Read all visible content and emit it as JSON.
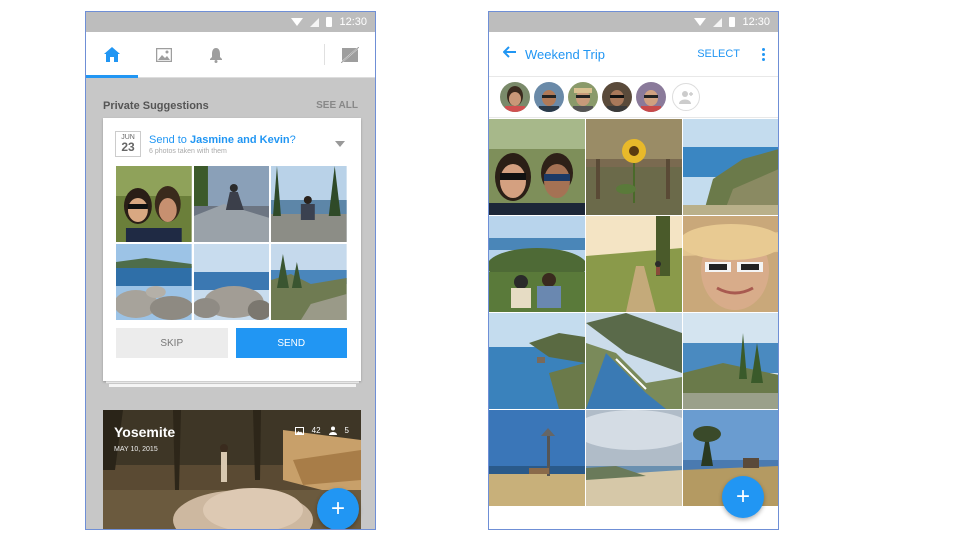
{
  "left_phone": {
    "status_time": "12:30",
    "tabs": [
      {
        "name": "home",
        "icon": "home-icon",
        "active": true
      },
      {
        "name": "photos",
        "icon": "photo-icon",
        "active": false
      },
      {
        "name": "notifications",
        "icon": "bell-icon",
        "active": false
      },
      {
        "name": "private",
        "icon": "no-sharing-icon",
        "active": false
      }
    ],
    "section_title": "Private Suggestions",
    "see_all": "SEE ALL",
    "suggestion": {
      "month": "JUN",
      "day": "23",
      "send_prefix": "Send to ",
      "recipients": "Jasmine and Kevin",
      "send_suffix": "?",
      "subtitle": "6 photos taken with them"
    },
    "skip_label": "SKIP",
    "send_label": "SEND",
    "album": {
      "title": "Yosemite",
      "date": "MAY 10, 2015",
      "photo_count": "42",
      "people_count": "5"
    },
    "fab_label": "+"
  },
  "right_phone": {
    "status_time": "12:30",
    "title": "Weekend Trip",
    "select_label": "SELECT",
    "fab_label": "+"
  },
  "colors": {
    "accent": "#2196f3",
    "frame": "#6f8fd6",
    "feed_bg": "#c7c7c7"
  }
}
